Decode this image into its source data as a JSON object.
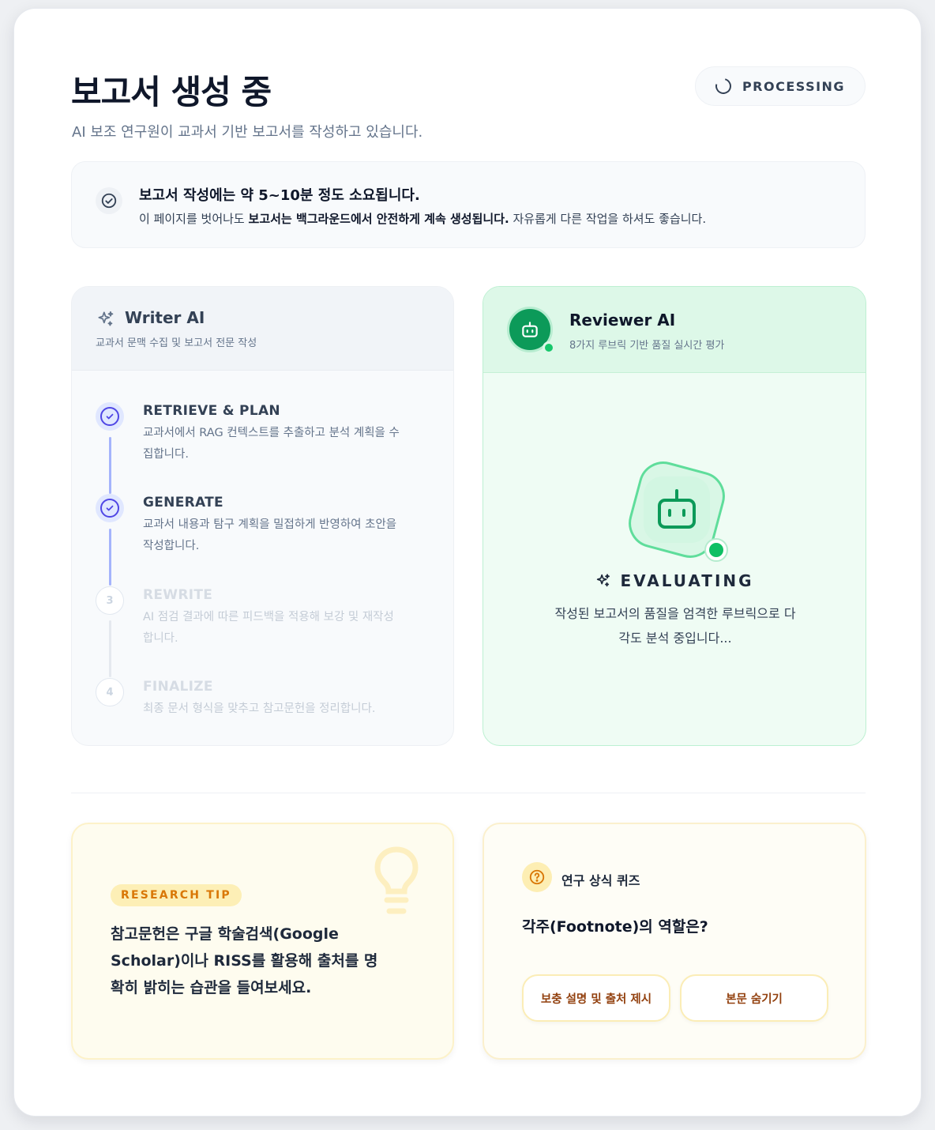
{
  "header": {
    "title": "보고서 생성 중",
    "subtitle": "AI 보조 연구원이 교과서 기반 보고서를 작성하고 있습니다.",
    "status": "PROCESSING"
  },
  "notice": {
    "title": "보고서 작성에는 약 5~10분 정도 소요됩니다.",
    "body_prefix": "이 페이지를 벗어나도 ",
    "body_bold": "보고서는 백그라운드에서 안전하게 계속 생성됩니다.",
    "body_suffix": " 자유롭게 다른 작업을 하셔도 좋습니다."
  },
  "writer": {
    "title": "Writer AI",
    "subtitle": "교과서 문맥 수집 및 보고서 전문 작성",
    "steps": [
      {
        "number": "1",
        "title": "RETRIEVE & PLAN",
        "description": "교과서에서 RAG 컨텍스트를 추출하고 분석 계획을 수\n집합니다.",
        "state": "done"
      },
      {
        "number": "2",
        "title": "GENERATE",
        "description": "교과서 내용과 탐구 계획을 밀접하게 반영하여 초안을\n작성합니다.",
        "state": "done"
      },
      {
        "number": "3",
        "title": "REWRITE",
        "description": "AI 점검 결과에 따른 피드백을 적용해 보강 및 재작성\n합니다.",
        "state": "pending"
      },
      {
        "number": "4",
        "title": "FINALIZE",
        "description": "최종 문서 형식을 맞추고 참고문헌을 정리합니다.",
        "state": "pending"
      }
    ]
  },
  "reviewer": {
    "title": "Reviewer AI",
    "subtitle": "8가지 루브릭 기반 품질 실시간 평가",
    "status_label": "EVALUATING",
    "status_desc": "작성된 보고서의 품질을 엄격한 루브릭으로 다\n각도 분석 중입니다..."
  },
  "tip": {
    "badge": "RESEARCH TIP",
    "text": "참고문헌은 구글 학술검색(Google Scholar)이나 RISS를 활용해 출처를 명확히 밝히는 습관을 들여보세요."
  },
  "quiz": {
    "label": "연구 상식 퀴즈",
    "question": "각주(Footnote)의 역할은?",
    "options": [
      "보충 설명 및 출처 제시",
      "본문 숨기기"
    ]
  },
  "colors": {
    "accent_indigo": "#4f46e5",
    "reviewer_green": "#0c9a59",
    "tip_amber": "#d97706"
  },
  "icons": {
    "status": "spinner-icon",
    "notice": "check-circle-icon",
    "writer": "sparkles-icon",
    "reviewer": "robot-icon",
    "tip": "lightbulb-icon",
    "quiz": "question-circle-icon"
  }
}
